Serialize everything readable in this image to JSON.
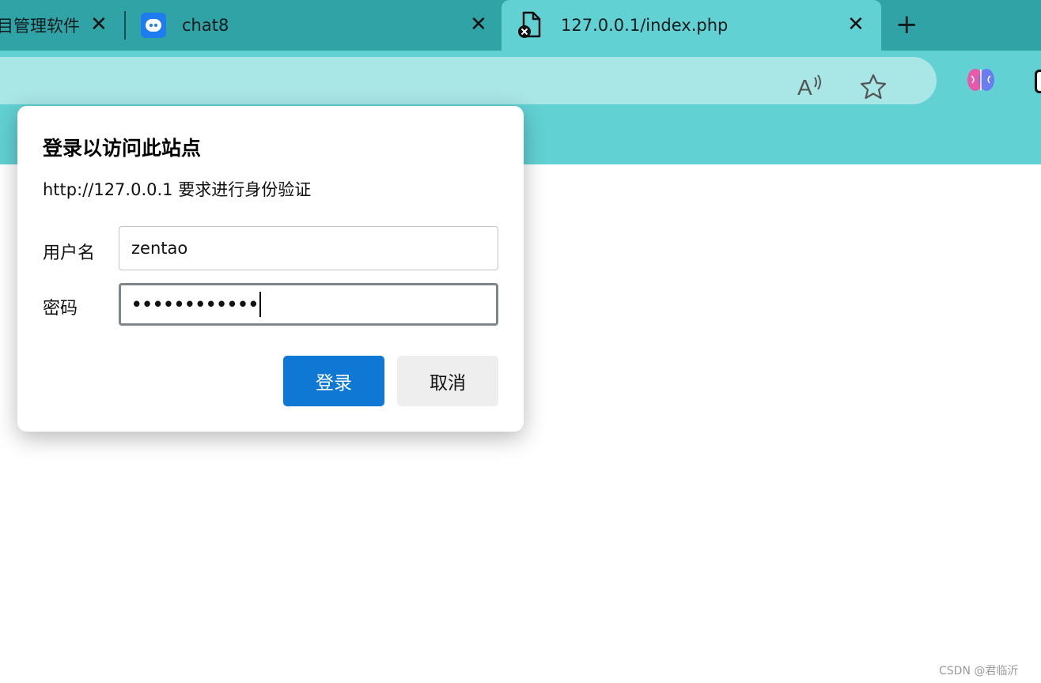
{
  "browser": {
    "tabs": [
      {
        "label": "目管理软件",
        "close_icon": "close-icon"
      },
      {
        "label": "chat8",
        "favicon": "chat-bubble-icon",
        "close_icon": "close-icon"
      },
      {
        "label": "127.0.0.1/index.php",
        "favicon": "file-error-icon",
        "active": true,
        "close_icon": "close-icon"
      }
    ],
    "new_tab_icon": "plus-icon",
    "toolbar_icons": [
      "read-aloud-icon",
      "favorite-star-icon",
      "brain-extension-icon"
    ],
    "colors": {
      "tabstrip": "#2fa3a6",
      "active_tab": "#62d1d3",
      "address_bar": "#a9e6e6"
    }
  },
  "dialog": {
    "title": "登录以访问此站点",
    "message": "http://127.0.0.1 要求进行身份验证",
    "username_label": "用户名",
    "username_value": "zentao",
    "password_label": "密码",
    "password_mask": "••••••••••••",
    "login_button": "登录",
    "cancel_button": "取消",
    "colors": {
      "primary_button": "#0f77d4"
    }
  },
  "watermark": "CSDN @君临沂"
}
